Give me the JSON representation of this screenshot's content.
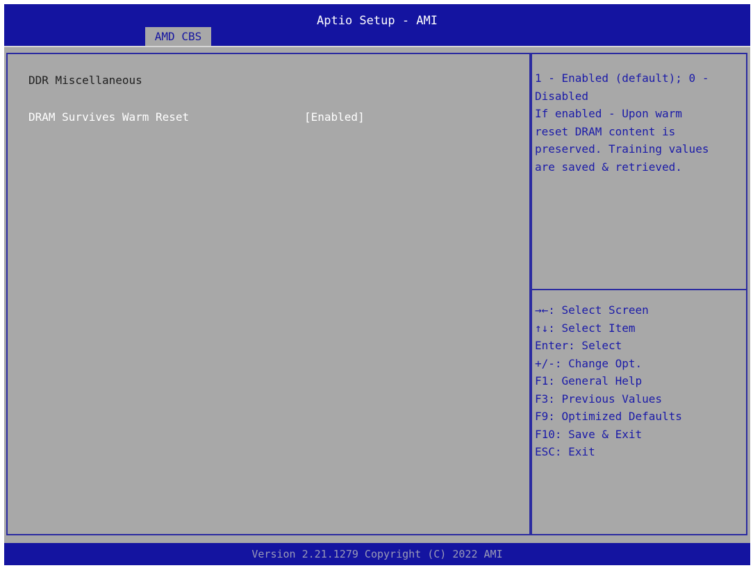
{
  "app": {
    "title": "Aptio Setup - AMI",
    "active_tab": "AMD CBS"
  },
  "main": {
    "section_title": "DDR Miscellaneous",
    "settings": [
      {
        "label": "DRAM Survives Warm Reset",
        "value": "[Enabled]"
      }
    ]
  },
  "help": {
    "lines": [
      "1 - Enabled (default); 0 -",
      "Disabled",
      "If enabled - Upon warm",
      "reset DRAM content is",
      "preserved. Training values",
      "are saved & retrieved."
    ]
  },
  "keys": [
    "→←: Select Screen",
    "↑↓: Select Item",
    "Enter: Select",
    "+/-: Change Opt.",
    "F1: General Help",
    "F3: Previous Values",
    "F9: Optimized Defaults",
    "F10: Save & Exit",
    "ESC: Exit"
  ],
  "footer": {
    "version": "Version 2.21.1279 Copyright (C) 2022 AMI"
  },
  "colors": {
    "header_bg": "#1414a0",
    "panel_bg": "#a8a8a8",
    "help_text": "#1a1aa8",
    "highlight_text": "#ffffff"
  }
}
